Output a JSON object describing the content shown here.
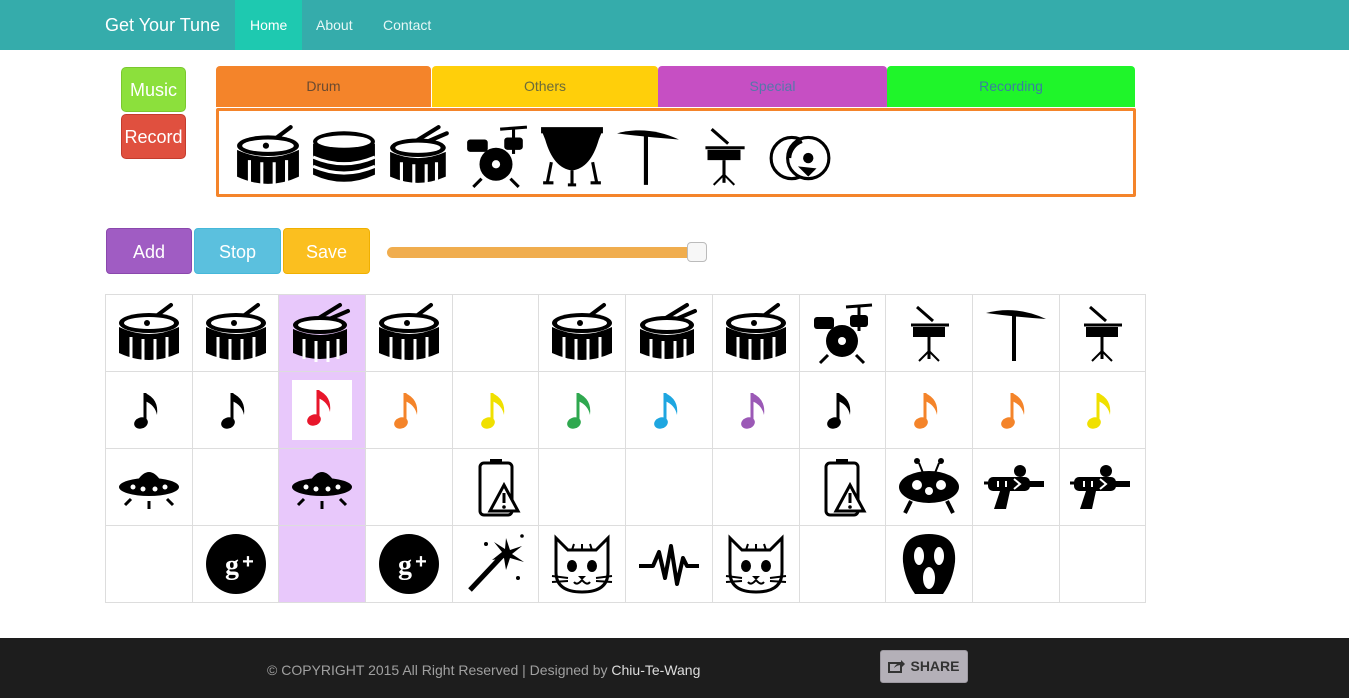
{
  "navbar": {
    "brand": "Get Your Tune",
    "items": [
      {
        "label": "Home",
        "active": true
      },
      {
        "label": "About",
        "active": false
      },
      {
        "label": "Contact",
        "active": false
      }
    ]
  },
  "sidebar": {
    "music_label": "Music",
    "record_label": "Record"
  },
  "tabs": [
    {
      "label": "Drum",
      "color": "#f4842a"
    },
    {
      "label": "Others",
      "color": "#ffcf0a"
    },
    {
      "label": "Special",
      "color": "#c64fc3"
    },
    {
      "label": "Recording",
      "color": "#1ff52a"
    }
  ],
  "palette": {
    "icons": [
      "drum-icon",
      "snare-drum-icon",
      "tom-drum-icon",
      "drum-kit-icon",
      "timpani-icon",
      "cymbal-icon",
      "hihat-icon",
      "cd-disc-icon"
    ]
  },
  "controls": {
    "add_label": "Add",
    "stop_label": "Stop",
    "save_label": "Save",
    "slider_value": 0.97
  },
  "grid": {
    "highlight_column": 3,
    "rows": [
      [
        "drum",
        "drum",
        "drum-stick",
        "drum",
        "",
        "drum",
        "drum-stick",
        "drum",
        "kit",
        "hihat",
        "cymbal",
        "hihat"
      ],
      [
        "note:#000000",
        "note:#000000",
        "note:#e8162b",
        "note:#f4842a",
        "note:#f0e000",
        "note:#2fa84f",
        "note:#1ea6e0",
        "note:#9b59b6",
        "note:#000000",
        "note:#f4842a",
        "note:#f4842a",
        "note:#f0e000"
      ],
      [
        "ufo",
        "",
        "ufo",
        "",
        "battery",
        "",
        "",
        "",
        "battery",
        "alien",
        "raygun",
        "raygun"
      ],
      [
        "",
        "gplus",
        "",
        "gplus",
        "sparkler",
        "cat",
        "pulse",
        "cat",
        "",
        "scream",
        "",
        ""
      ]
    ]
  },
  "footer": {
    "copyright_prefix": "© COPYRIGHT 2015 All Right Reserved | Designed by ",
    "author": "Chiu-Te-Wang",
    "share_label": "SHARE"
  }
}
